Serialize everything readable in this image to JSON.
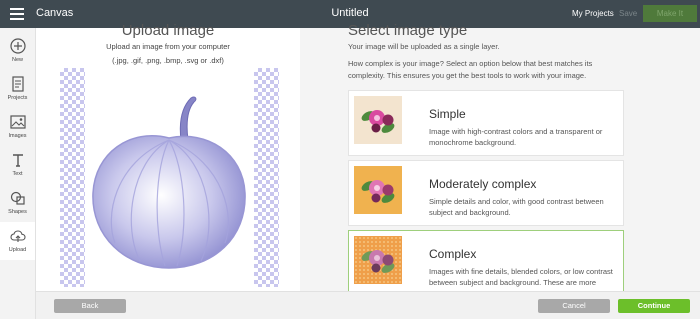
{
  "topbar": {
    "app_title": "Canvas",
    "document_title": "Untitled",
    "my_projects": "My Projects",
    "save": "Save",
    "make_it": "Make It"
  },
  "sidebar": {
    "items": [
      {
        "label": "New",
        "icon": "plus-circle-icon"
      },
      {
        "label": "Projects",
        "icon": "projects-icon"
      },
      {
        "label": "Images",
        "icon": "images-icon"
      },
      {
        "label": "Text",
        "icon": "text-icon"
      },
      {
        "label": "Shapes",
        "icon": "shapes-icon"
      },
      {
        "label": "Upload",
        "icon": "upload-icon"
      }
    ],
    "active": "Upload"
  },
  "upload": {
    "title": "Upload image",
    "subtitle": "Upload an image from your computer",
    "formats": "(.jpg, .gif, .png, .bmp, .svg or .dxf)"
  },
  "image_type": {
    "title": "Select image type",
    "subtitle": "Your image will be uploaded as a single layer.",
    "description": "How complex is your image? Select an option below that best matches its complexity. This ensures you get the best tools to work with your image.",
    "options": [
      {
        "name": "Simple",
        "description": "Image with high-contrast colors and a transparent or monochrome background.",
        "selected": false
      },
      {
        "name": "Moderately complex",
        "description": "Simple details and color, with good contrast between subject and background.",
        "selected": false
      },
      {
        "name": "Complex",
        "description": "Images with fine details, blended colors, or low contrast between subject and background. These are more",
        "selected": true
      }
    ]
  },
  "footer": {
    "back": "Back",
    "cancel": "Cancel",
    "continue": "Continue"
  },
  "colors": {
    "topbar": "#3f4a51",
    "accent_green": "#6cbf2a",
    "selected_border": "#9ecf7c"
  }
}
